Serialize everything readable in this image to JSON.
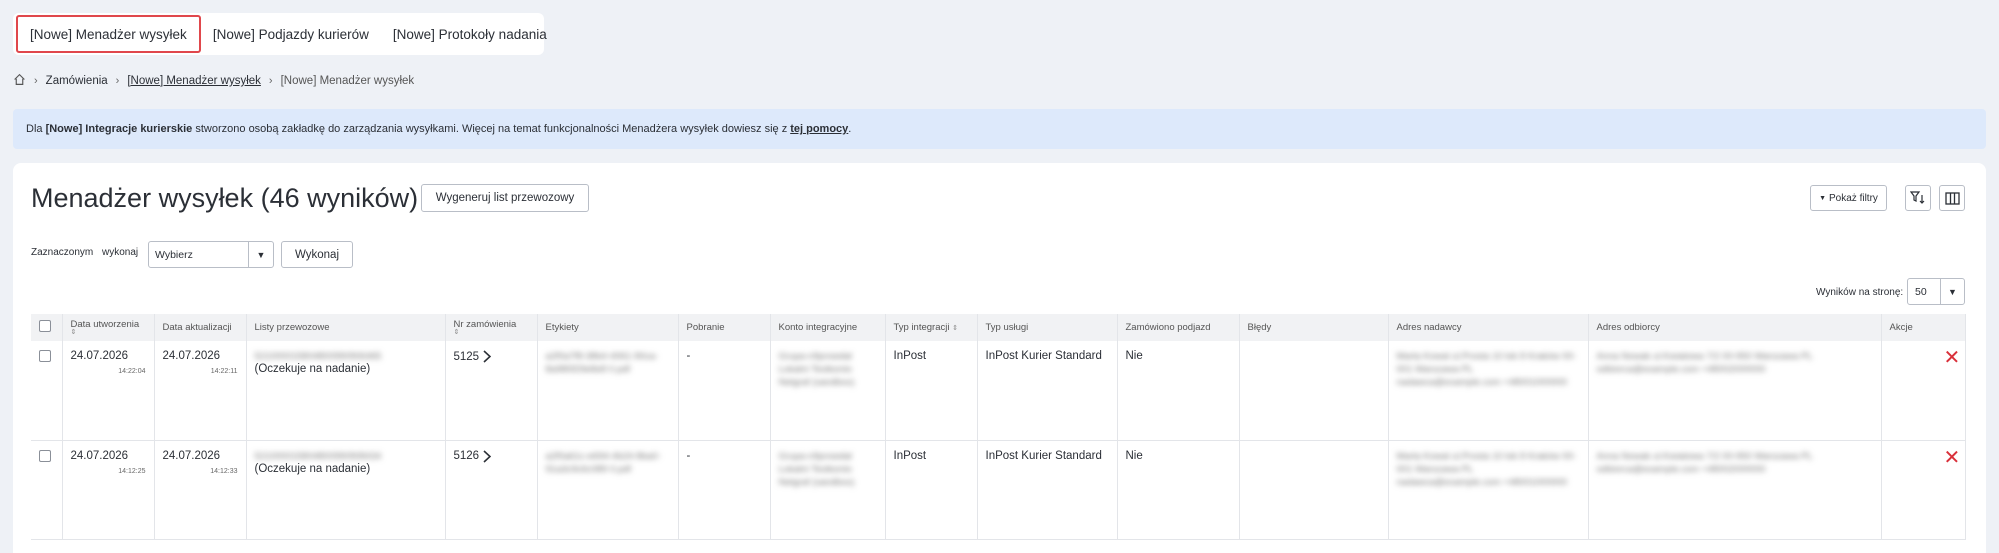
{
  "tabs": [
    {
      "label": "[Nowe] Menadżer wysyłek",
      "active": true
    },
    {
      "label": "[Nowe] Podjazdy kurierów",
      "active": false
    },
    {
      "label": "[Nowe] Protokoły nadania",
      "active": false
    }
  ],
  "breadcrumb": {
    "home_icon": "home-icon",
    "item1": "Zamówienia",
    "item2": "[Nowe] Menadżer wysyłek",
    "current": "[Nowe] Menadżer wysyłek"
  },
  "info": {
    "prefix": "Dla",
    "bold": "[Nowe] Integracje kurierskie",
    "text": "stworzono osobą zakładkę do zarządzania wysyłkami. Więcej na temat funkcjonalności Menadżera wysyłek dowiesz się z",
    "link": "tej pomocy",
    "suffix": "."
  },
  "main": {
    "title": "Menadżer wysyłek (46 wyników)",
    "generate_button": "Wygeneruj list przewozowy",
    "show_filters_button": "Pokaż filtry",
    "selected_label": "Zaznaczonym",
    "execute_label": "wykonaj",
    "select_value": "Wybierz",
    "execute_button": "Wykonaj",
    "per_page_label": "Wyników na stronę:",
    "per_page_value": "50"
  },
  "table": {
    "headers": [
      "Data utworzenia",
      "Data aktualizacji",
      "Listy przewozowe",
      "Nr zamówienia",
      "Etykiety",
      "Pobranie",
      "Konto integracyjne",
      "Typ integracji",
      "Typ usługi",
      "Zamówiono podjazd",
      "Błędy",
      "Adres nadawcy",
      "Adres odbiorcy",
      "Akcje"
    ],
    "rows": [
      {
        "created_date": "24.07.2026",
        "created_time": "14:22:04",
        "updated_date": "24.07.2026",
        "updated_time": "14:22:11",
        "tracking": "521000015804800990906465",
        "status": "(Oczekuje na nadanie)",
        "order": "5125",
        "label": "a2f0a7f8-38b4-4061-90ca-8a980f29e8e8 0.pdf",
        "cod": "-",
        "account": "Grupa-n9prowdal Lokalni Testkonto Netgraf (sandbox)",
        "integration": "InPost",
        "service": "InPost Kurier Standard",
        "pickup": "Nie",
        "sender": "Marta Kowal ul.Prosta 10 lok 8 Kraków 00-001 Warszawa PL nadawca@example.com +48001000000",
        "receiver": "Anna Nowak ul.Kwiatowa 7/2 00-950 Warszawa PL odbiorca@example.com +48002000000"
      },
      {
        "created_date": "24.07.2026",
        "created_time": "14:12:25",
        "updated_date": "24.07.2026",
        "updated_time": "14:12:33",
        "tracking": "521000015804800990908434",
        "status": "(Oczekuje na nadanie)",
        "order": "5126",
        "label": "a2f0a61c-e694-4b24-8ba0-91a3c9c6c089 0.pdf",
        "cod": "-",
        "account": "Grupa-n9prowdal Lokalni Testkonto Netgraf (sandbox)",
        "integration": "InPost",
        "service": "InPost Kurier Standard",
        "pickup": "Nie",
        "sender": "Marta Kowal ul.Prosta 10 lok 8 Kraków 00-001 Warszawa PL nadawca@example.com +48001000000",
        "receiver": "Anna Nowak ul.Kwiatowa 7/2 00-950 Warszawa PL odbiorca@example.com +48002000000"
      }
    ]
  }
}
